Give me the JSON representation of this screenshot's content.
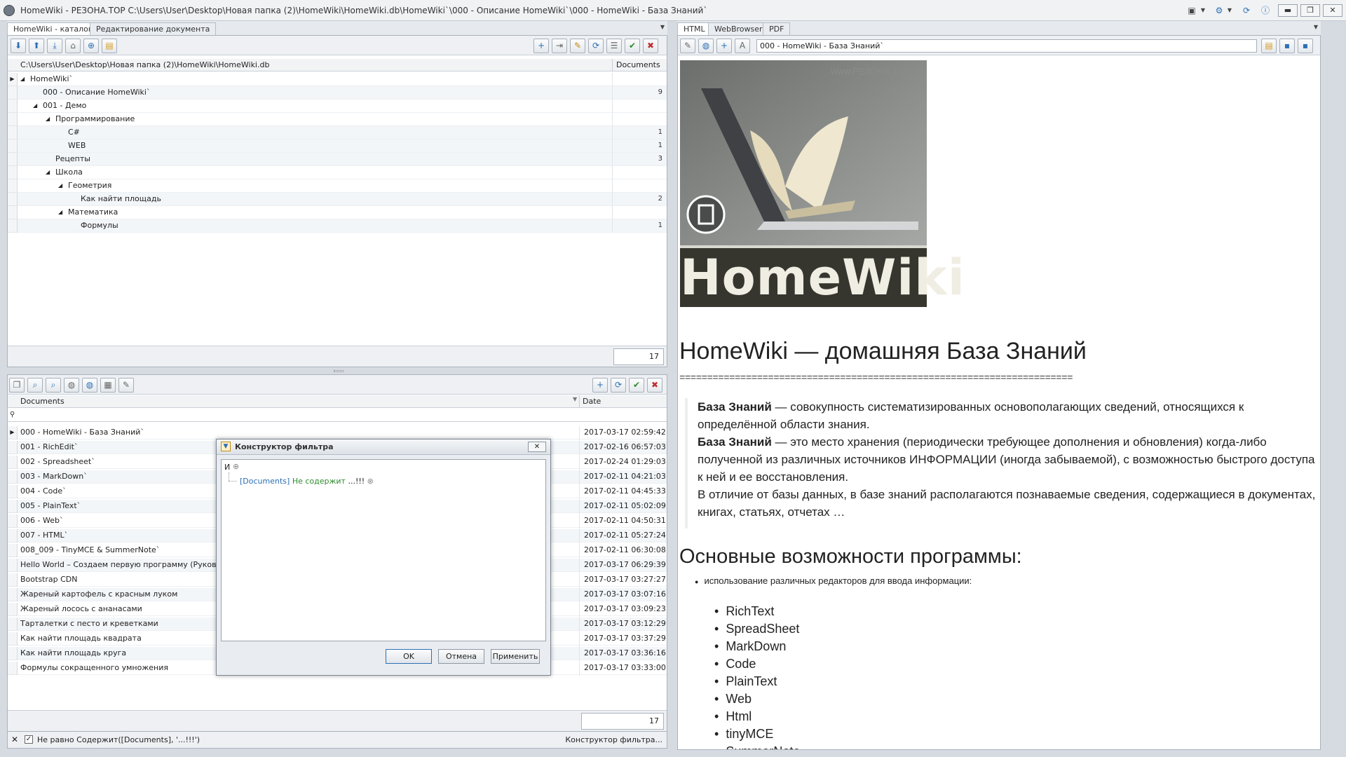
{
  "window": {
    "title": "HomeWiki - РЕЗОНА.ТОР   C:\\Users\\User\\Desktop\\Новая папка (2)\\HomeWiki\\HomeWiki.db\\HomeWiki`\\000 - Описание HomeWiki`\\000 - HomeWiki - База Знаний`",
    "minimize": "▬",
    "maximize": "❐",
    "close": "✕"
  },
  "left_tabs": [
    "HomeWiki - каталог",
    "Редактирование документа"
  ],
  "catalog": {
    "path_header": "C:\\Users\\User\\Desktop\\Новая папка (2)\\HomeWiki\\HomeWiki.db",
    "count_header": "Documents",
    "rows": [
      {
        "label": "HomeWiki`",
        "count": ""
      },
      {
        "label": "000 - Описание HomeWiki`",
        "count": "9"
      },
      {
        "label": "001 - Демо",
        "count": ""
      },
      {
        "label": "Программирование",
        "count": ""
      },
      {
        "label": "C#",
        "count": "1"
      },
      {
        "label": "WEB",
        "count": "1"
      },
      {
        "label": "Рецепты",
        "count": "3"
      },
      {
        "label": "Школа",
        "count": ""
      },
      {
        "label": "Геометрия",
        "count": ""
      },
      {
        "label": "Как найти площадь",
        "count": "2"
      },
      {
        "label": "Математика",
        "count": ""
      },
      {
        "label": "Формулы",
        "count": "1"
      }
    ],
    "total": "17"
  },
  "documents": {
    "col_documents": "Documents",
    "col_date": "Date",
    "rows": [
      {
        "title": "000 - HomeWiki - База Знаний`",
        "date": "2017-03-17 02:59:42"
      },
      {
        "title": "001 - RichEdit`",
        "date": "2017-02-16 06:57:03"
      },
      {
        "title": "002 - Spreadsheet`",
        "date": "2017-02-24 01:29:03"
      },
      {
        "title": "003 - MarkDown`",
        "date": "2017-02-11 04:21:03"
      },
      {
        "title": "004 - Code`",
        "date": "2017-02-11 04:45:33"
      },
      {
        "title": "005 - PlainText`",
        "date": "2017-02-11 05:02:09"
      },
      {
        "title": "006 - Web`",
        "date": "2017-02-11 04:50:31"
      },
      {
        "title": "007 - HTML`",
        "date": "2017-02-11 05:27:24"
      },
      {
        "title": "008_009 - TinyMCE  &  SummerNote`",
        "date": "2017-02-11 06:30:08"
      },
      {
        "title": "Hello World – Создаем первую программу (Руководство",
        "date": "2017-03-17 06:29:39"
      },
      {
        "title": "Bootstrap CDN",
        "date": "2017-03-17 03:27:27"
      },
      {
        "title": "Жареный картофель с красным луком",
        "date": "2017-03-17 03:07:16"
      },
      {
        "title": "Жареный лосось с ананасами",
        "date": "2017-03-17 03:09:23"
      },
      {
        "title": "Тарталетки с песто и креветками",
        "date": "2017-03-17 03:12:29"
      },
      {
        "title": "Как найти площадь квадрата",
        "date": "2017-03-17 03:37:29"
      },
      {
        "title": "Как найти площадь круга",
        "date": "2017-03-17 03:36:16"
      },
      {
        "title": "Формулы сокращенного умножения",
        "date": "2017-03-17 03:33:00"
      }
    ],
    "total": "17"
  },
  "filter_bar": {
    "text": "Не равно Содержит([Documents], '...!!!')",
    "link": "Конструктор фильтра..."
  },
  "dialog": {
    "title": "Конструктор фильтра",
    "root": "И",
    "condition_field": "[Documents]",
    "condition_op": "Не содержит",
    "condition_value": "...!!!",
    "ok": "OK",
    "cancel": "Отмена",
    "apply": "Применить"
  },
  "right_tabs": [
    "HTML",
    "WebBrowser",
    "PDF"
  ],
  "address": "000 - HomeWiki - База Знаний`",
  "content": {
    "image_watermark": "www.РЕЗОНА.ТОР",
    "image_title": "HomeWiki",
    "h1": "HomeWiki — домашняя База Знаний",
    "separator": "=======================================================================",
    "p1_bold": "База Знаний",
    "p1_text": " — совокупность систематизированных основополагающих сведений, относящихся к определённой области знания.",
    "p2_bold": "База Знаний",
    "p2_text": " — это место хранения (периодически требующее дополнения и обновления) когда-либо полученной из различных источников ИНФОРМАЦИИ (иногда забываемой), с возможностью быстрого доступа к ней и ее восстановления.",
    "p3_text": "В отличие от базы данных, в базе знаний располагаются познаваемые сведения, содержащиеся в документах, книгах, статьях, отчетах …",
    "h2": "Основные возможности программы:",
    "small_bullet": "использование различных редакторов для ввода информации:",
    "editors": [
      "RichText",
      "SpreadSheet",
      "MarkDown",
      "Code",
      "PlainText",
      "Web",
      "Html",
      "tinyMCE",
      "SummerNote"
    ]
  },
  "colors": {
    "accent": "#2c6fb5",
    "panel_bg": "#ffffff",
    "chrome_bg": "#d6dbe1"
  }
}
